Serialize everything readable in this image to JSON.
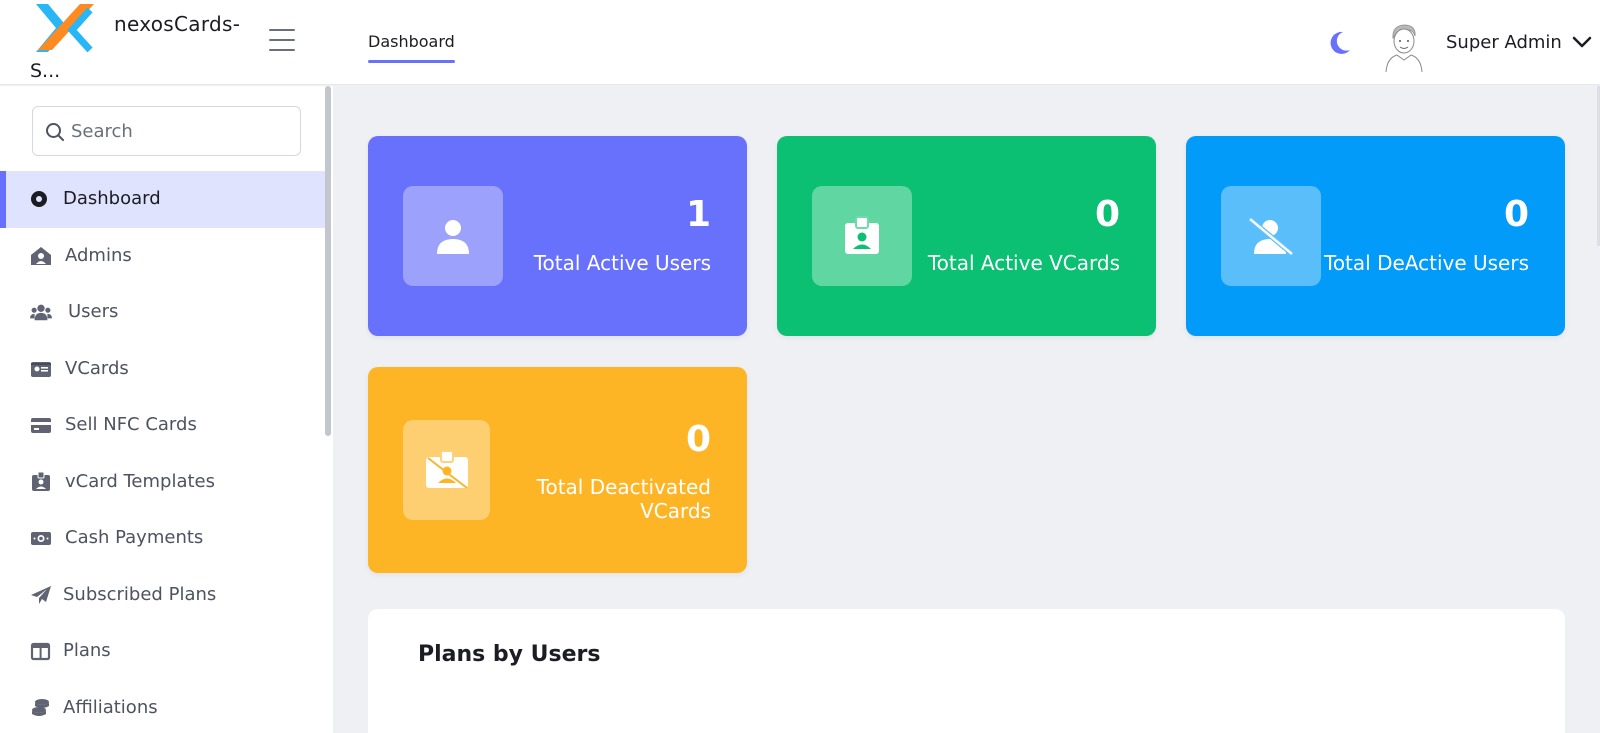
{
  "app": {
    "brand_name": "nexosCards-",
    "brand_name_overflow": "S..."
  },
  "header": {
    "tab_label": "Dashboard",
    "user_name": "Super Admin",
    "accent_color": "#6871fb"
  },
  "search": {
    "placeholder": "Search",
    "value": ""
  },
  "sidebar": {
    "items": [
      {
        "label": "Dashboard",
        "icon": "circle-dot-icon",
        "active": true
      },
      {
        "label": "Admins",
        "icon": "home-user-icon"
      },
      {
        "label": "Users",
        "icon": "users-icon"
      },
      {
        "label": "VCards",
        "icon": "id-card-icon"
      },
      {
        "label": "Sell NFC Cards",
        "icon": "credit-card-icon"
      },
      {
        "label": "vCard Templates",
        "icon": "id-badge-icon"
      },
      {
        "label": "Cash Payments",
        "icon": "money-bill-icon"
      },
      {
        "label": "Subscribed Plans",
        "icon": "paper-plane-icon"
      },
      {
        "label": "Plans",
        "icon": "table-columns-icon"
      },
      {
        "label": "Affiliations",
        "icon": "coins-icon"
      }
    ]
  },
  "cards": [
    {
      "count": "1",
      "label": "Total Active Users",
      "color": "#6871fb",
      "icon": "user-icon"
    },
    {
      "count": "0",
      "label": "Total Active VCards",
      "color": "#0bc072",
      "icon": "id-badge-icon"
    },
    {
      "count": "0",
      "label": "Total DeActive Users",
      "color": "#039bf9",
      "icon": "user-slash-icon"
    },
    {
      "count": "0",
      "label_line1": "Total Deactivated",
      "label_line2": "VCards",
      "color": "#fdb526",
      "icon": "id-badge-slash-icon"
    }
  ],
  "panel": {
    "title": "Plans by Users"
  }
}
